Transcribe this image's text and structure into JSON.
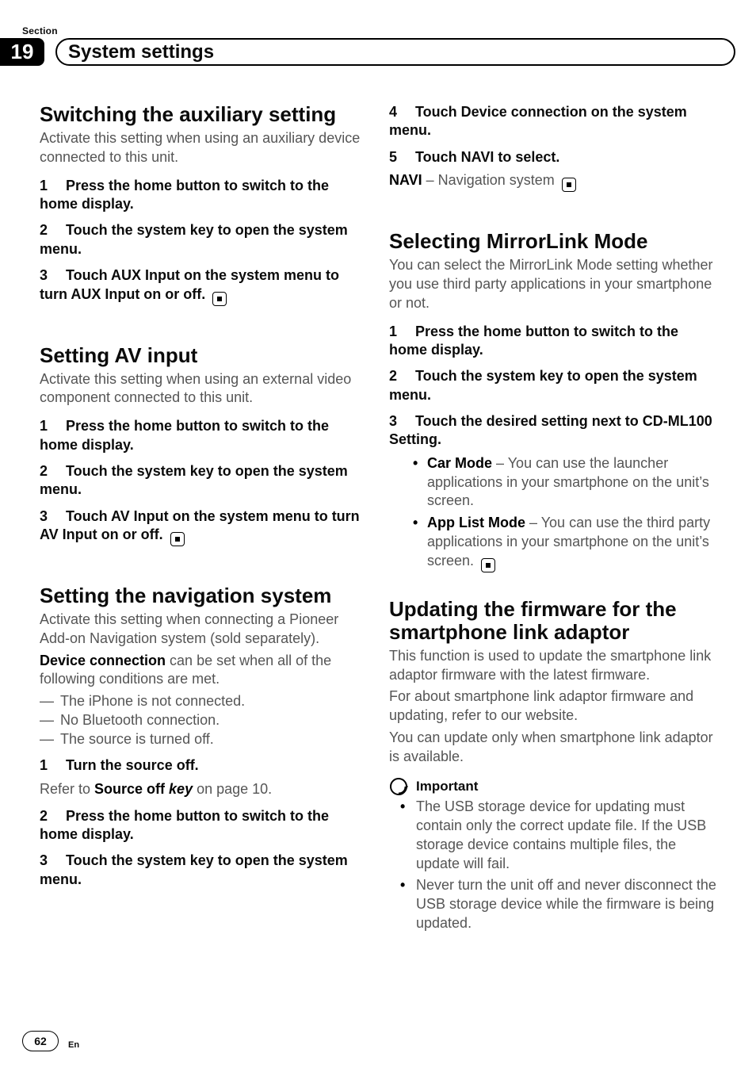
{
  "header": {
    "section_label": "Section",
    "section_number": "19",
    "chapter_title": "System settings"
  },
  "left": {
    "aux": {
      "heading": "Switching the auxiliary setting",
      "intro": "Activate this setting when using an auxiliary device connected to this unit.",
      "steps": [
        {
          "n": "1",
          "text": "Press the home button to switch to the home display."
        },
        {
          "n": "2",
          "text": "Touch the system key to open the system menu."
        },
        {
          "n": "3",
          "text": "Touch AUX Input on the system menu to turn AUX Input on or off."
        }
      ]
    },
    "av": {
      "heading": "Setting AV input",
      "intro": "Activate this setting when using an external video component connected to this unit.",
      "steps": [
        {
          "n": "1",
          "text": "Press the home button to switch to the home display."
        },
        {
          "n": "2",
          "text": "Touch the system key to open the system menu."
        },
        {
          "n": "3",
          "text": "Touch AV Input on the system menu to turn AV Input on or off."
        }
      ]
    },
    "nav": {
      "heading": "Setting the navigation system",
      "intro": "Activate this setting when connecting a Pioneer Add-on Navigation system (sold separately).",
      "device_conn_bold": "Device connection",
      "device_conn_rest": " can be set when all of the following conditions are met.",
      "conditions": [
        "The iPhone is not connected.",
        "No Bluetooth connection.",
        "The source is turned off."
      ],
      "s1_n": "1",
      "s1_text": "Turn the source off.",
      "s1_ref_pre": "Refer to ",
      "s1_ref_bold": "Source off",
      "s1_ref_italic": " key",
      "s1_ref_post": " on page 10.",
      "s2_n": "2",
      "s2_text": "Press the home button to switch to the home display.",
      "s3_n": "3",
      "s3_text": "Touch the system key to open the system menu."
    }
  },
  "right": {
    "nav_cont": {
      "s4_n": "4",
      "s4_text": "Touch Device connection on the system menu.",
      "s5_n": "5",
      "s5_text": "Touch NAVI to select.",
      "s5_line_bold": "NAVI",
      "s5_line_rest": " – Navigation system"
    },
    "mirror": {
      "heading": "Selecting MirrorLink Mode",
      "intro": "You can select the MirrorLink Mode setting whether you use third party applications in your smartphone or not.",
      "steps": [
        {
          "n": "1",
          "text": "Press the home button to switch to the home display."
        },
        {
          "n": "2",
          "text": "Touch the system key to open the system menu."
        },
        {
          "n": "3",
          "text": "Touch the desired setting next to CD-ML100 Setting."
        }
      ],
      "bullets": [
        {
          "bold": "Car Mode",
          "rest": " – You can use the launcher applications in your smartphone on the unit’s screen."
        },
        {
          "bold": "App List Mode",
          "rest": " – You can use the third party applications in your smartphone on the unit’s screen."
        }
      ]
    },
    "firmware": {
      "heading": "Updating the firmware for the smartphone link adaptor",
      "p1": "This function is used to update the smartphone link adaptor firmware with the latest firmware.",
      "p2": "For about smartphone link adaptor firmware and updating, refer to our website.",
      "p3": "You can update only when smartphone link adaptor is available.",
      "important_label": "Important",
      "important": [
        "The USB storage device for updating must contain only the correct update file. If the USB storage device contains multiple files, the update will fail.",
        "Never turn the unit off and never disconnect the USB storage device while the firmware is being updated."
      ]
    }
  },
  "footer": {
    "page": "62",
    "lang": "En"
  }
}
